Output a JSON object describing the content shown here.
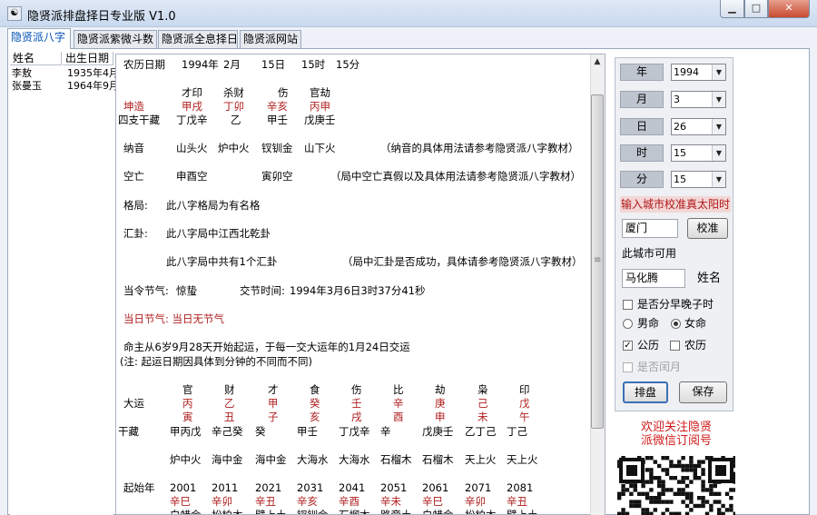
{
  "window": {
    "title": "隐贤派排盘择日专业版 V1.0",
    "app_icon": "yin-yang-icon"
  },
  "tabs": [
    {
      "label": "隐贤派八字",
      "active": true
    },
    {
      "label": "隐贤派紫微斗数",
      "active": false
    },
    {
      "label": "隐贤派全息择日",
      "active": false
    },
    {
      "label": "隐贤派网站",
      "active": false
    }
  ],
  "person_list": {
    "headers": [
      "姓名",
      "出生日期"
    ],
    "rows": [
      {
        "name": "李敖",
        "date": "1935年4月"
      },
      {
        "name": "张曼玉",
        "date": "1964年9月"
      }
    ]
  },
  "result": {
    "lunar_line": {
      "label": "农历日期",
      "year": "1994年",
      "month": "2月",
      "day": "15日",
      "hour": "15时",
      "minute": "15分"
    },
    "pillars": {
      "gods": [
        "才印",
        "杀财",
        "伤",
        "官劫"
      ],
      "label": "坤造",
      "ganzhi": [
        "甲戌",
        "丁卯",
        "辛亥",
        "丙申"
      ],
      "hidden_label": "四支干藏",
      "hidden": [
        "丁戊辛",
        "乙",
        "甲壬",
        "戊庚壬"
      ]
    },
    "nayin": {
      "label": "纳音",
      "values": [
        "山头火",
        "炉中火",
        "钗钏金",
        "山下火"
      ],
      "note": "（纳音的具体用法请参考隐贤派八字教材）"
    },
    "kongwang": {
      "label": "空亡",
      "values": [
        "申酉空",
        "寅卯空"
      ],
      "note": "（局中空亡真假以及具体用法请参考隐贤派八字教材）"
    },
    "geju": {
      "label": "格局:",
      "text": "此八字格局为有名格"
    },
    "huigua": {
      "label": "汇卦:",
      "text": "此八字局中江西北乾卦"
    },
    "huigua2": {
      "text": "此八字局中共有1个汇卦",
      "note": "（局中汇卦是否成功，具体请参考隐贤派八字教材）"
    },
    "jieqi": {
      "label": "当令节气:",
      "value": "惊蛰",
      "time_label": "交节时间:",
      "time": "1994年3月6日3时37分41秒"
    },
    "today_jieqi": "当日节气: 当日无节气",
    "qiyun": "命主从6岁9月28天开始起运，于每一交大运年的1月24日交运",
    "qiyun_note": "(注: 起运日期因具体到分钟的不同而不同)",
    "dayun": {
      "gods": [
        "官",
        "财",
        "才",
        "食",
        "伤",
        "比",
        "劫",
        "枭",
        "印"
      ],
      "label": "大运",
      "stems": [
        "丙",
        "乙",
        "甲",
        "癸",
        "壬",
        "辛",
        "庚",
        "己",
        "戊"
      ],
      "branches": [
        "寅",
        "丑",
        "子",
        "亥",
        "戌",
        "酉",
        "申",
        "未",
        "午"
      ],
      "hidden_label": "干藏",
      "hidden": [
        "甲丙戊",
        "辛己癸",
        "癸",
        "甲壬",
        "丁戊辛",
        "辛",
        "戊庚壬",
        "乙丁己",
        "丁己"
      ],
      "nayin": [
        "炉中火",
        "海中金",
        "海中金",
        "大海水",
        "大海水",
        "石榴木",
        "石榴木",
        "天上火",
        "天上火"
      ],
      "start_label": "起始年",
      "years": [
        "2001",
        "2011",
        "2021",
        "2031",
        "2041",
        "2051",
        "2061",
        "2071",
        "2081"
      ],
      "year_ganzhi": [
        "辛巳",
        "辛卯",
        "辛丑",
        "辛亥",
        "辛酉",
        "辛未",
        "辛巳",
        "辛卯",
        "辛丑"
      ],
      "partial_row": [
        "白蜡金",
        "松柏木",
        "壁上土",
        "钗钏金",
        "石榴木",
        "路旁土",
        "白蜡金",
        "松柏木",
        "壁上土"
      ]
    }
  },
  "side_panel": {
    "fields": [
      {
        "label": "年",
        "value": "1994"
      },
      {
        "label": "月",
        "value": "3"
      },
      {
        "label": "日",
        "value": "26"
      },
      {
        "label": "时",
        "value": "15"
      },
      {
        "label": "分",
        "value": "15"
      }
    ],
    "verify_title": "输入城市校准真太阳时",
    "city_value": "厦门",
    "verify_button": "校准",
    "city_available": "此城市可用",
    "name_value": "马化腾",
    "name_label": "姓名",
    "split_zi": "是否分早晚子时",
    "male": "男命",
    "female": "女命",
    "gregorian": "公历",
    "lunar": "农历",
    "leap": "是否闰月",
    "chart_button": "排盘",
    "save_button": "保存"
  },
  "promo": {
    "line1": "欢迎关注隐贤",
    "line2": "派微信订阅号"
  }
}
